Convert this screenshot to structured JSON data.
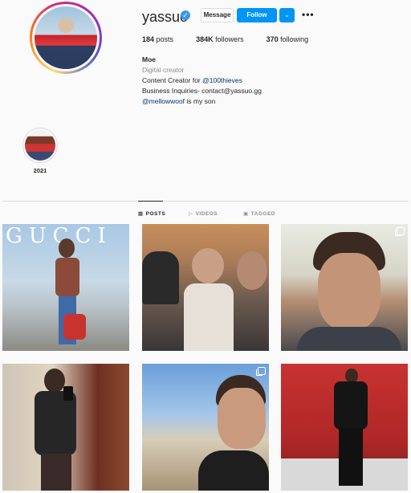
{
  "profile": {
    "username": "yassuo",
    "message_label": "Message",
    "follow_label": "Follow",
    "more_label": "•••",
    "stats": {
      "posts_count": "184",
      "posts_label": "posts",
      "followers_count": "384K",
      "followers_label": "followers",
      "following_count": "370",
      "following_label": "following"
    },
    "bio": {
      "name": "Moe",
      "category": "Digital creator",
      "line1_prefix": "Content Creator for ",
      "line1_link": "@100thieves",
      "line2": "Business Inquiries- contact@yassuo.gg",
      "line3_link": "@mellowwoof",
      "line3_suffix": " is my son"
    }
  },
  "highlights": [
    {
      "label": "2021"
    }
  ],
  "tabs": [
    {
      "label": "POSTS",
      "icon": "grid-icon",
      "active": true
    },
    {
      "label": "VIDEOS",
      "icon": "video-icon",
      "active": false
    },
    {
      "label": "TAGGED",
      "icon": "tag-icon",
      "active": false
    }
  ],
  "posts": [
    {
      "overlay_text": "GUCCI",
      "multi": false
    },
    {
      "overlay_text": "",
      "multi": false
    },
    {
      "overlay_text": "",
      "multi": true
    },
    {
      "overlay_text": "",
      "multi": false
    },
    {
      "overlay_text": "",
      "multi": true
    },
    {
      "overlay_text": "",
      "multi": false
    }
  ],
  "colors": {
    "accent": "#0095f6",
    "verified": "#3897f0",
    "link": "#00376b",
    "muted": "#8e8e8e"
  }
}
